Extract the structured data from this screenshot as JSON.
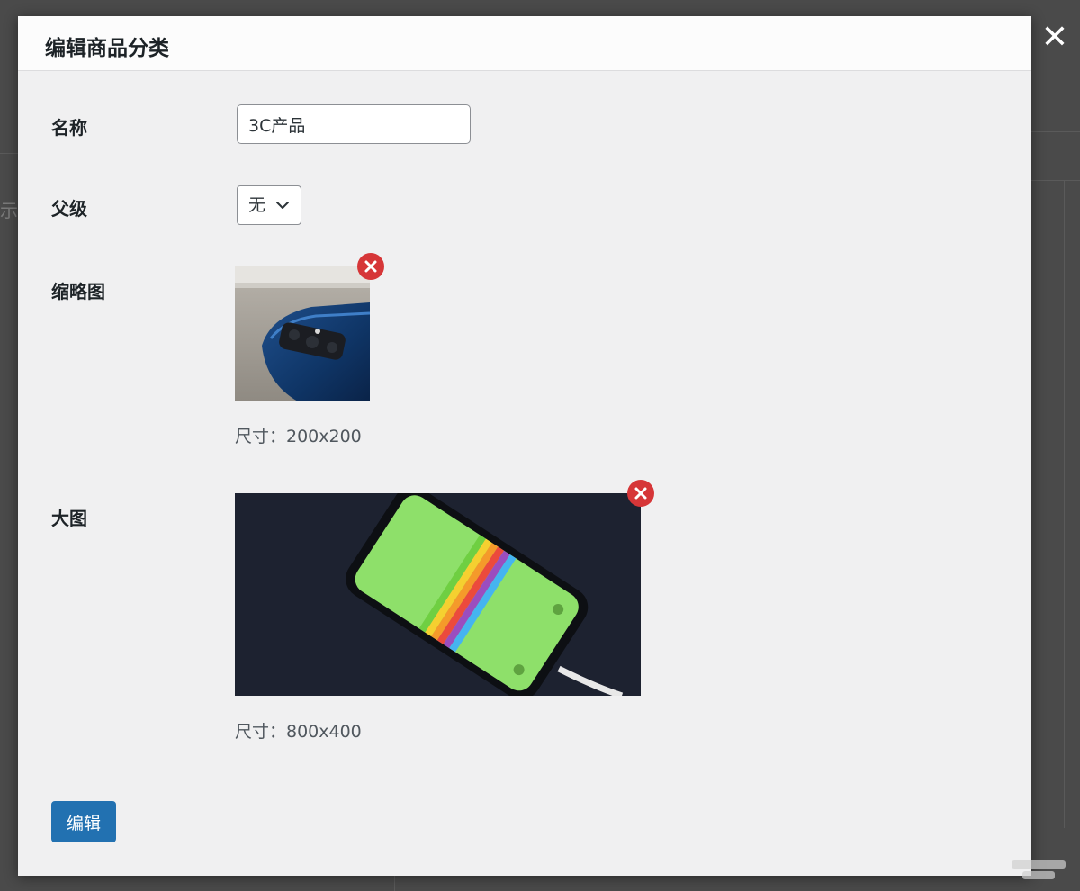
{
  "modal": {
    "title": "编辑商品分类",
    "close_glyph": "✕"
  },
  "form": {
    "name": {
      "label": "名称",
      "value": "3C产品"
    },
    "parent": {
      "label": "父级",
      "selected": "无"
    },
    "thumbnail": {
      "label": "缩略图",
      "size_note": "尺寸：200x200"
    },
    "large_image": {
      "label": "大图",
      "size_note": "尺寸：800x400"
    },
    "submit_label": "编辑"
  },
  "background": {
    "partial_text": "示"
  },
  "icons": {
    "close": "close-icon",
    "select": "chevron-down-icon",
    "remove": "remove-image-icon"
  },
  "colors": {
    "primary": "#2271b1",
    "danger": "#d63638",
    "backdrop": "#4a4a4a",
    "panel": "#f0f0f1"
  }
}
